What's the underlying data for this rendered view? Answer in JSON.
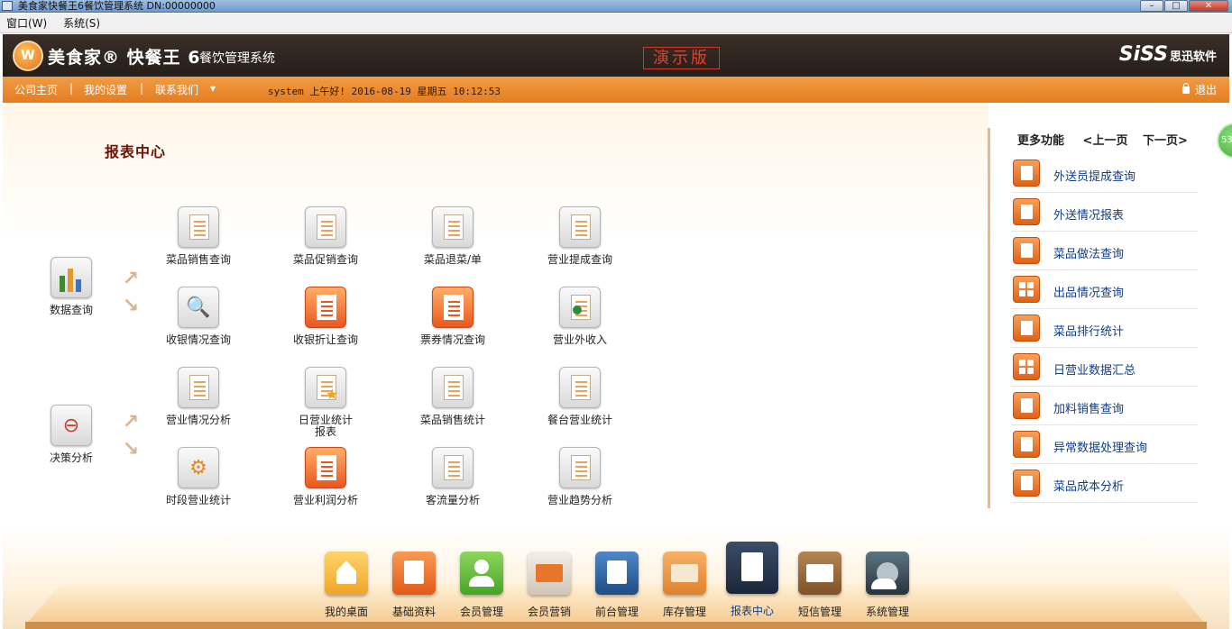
{
  "window": {
    "title": "美食家快餐王6餐饮管理系统 DN:00000000",
    "min_label": "–",
    "max_label": "□",
    "close_label": "✕"
  },
  "menubar": {
    "items": [
      "窗口(W)",
      "系统(S)"
    ]
  },
  "header": {
    "brand": "美食家® 快餐王 6",
    "subtitle": "餐饮管理系统",
    "demo_badge": "演示版",
    "vendor": "SiSS",
    "vendor_cn": "思迅软件",
    "logo_glyph": "W"
  },
  "nav": {
    "home": "公司主页",
    "settings": "我的设置",
    "contact": "联系我们",
    "contact_caret": "▾",
    "separator": "|",
    "greeting": "system 上午好! 2016-08-19 星期五 10:12:53",
    "logout": "退出"
  },
  "main": {
    "section_title": "报表中心",
    "groups": [
      {
        "label": "数据查询",
        "icon": "bar-chart-icon"
      },
      {
        "label": "决策分析",
        "icon": "cart-icon"
      }
    ],
    "arrow_up": "↗",
    "arrow_down": "↘",
    "tiles": [
      {
        "label": "菜品销售查询",
        "icon": "clipboard-icon"
      },
      {
        "label": "菜品促销查询",
        "icon": "document-icon"
      },
      {
        "label": "菜品退菜/单",
        "icon": "document-icon"
      },
      {
        "label": "营业提成查询",
        "icon": "document-icon"
      },
      {
        "label": "收银情况查询",
        "icon": "magnifier-cash-icon"
      },
      {
        "label": "收银折让查询",
        "icon": "orange-document-icon"
      },
      {
        "label": "票券情况查询",
        "icon": "orange-document-icon"
      },
      {
        "label": "营业外收入",
        "icon": "person-document-icon"
      },
      {
        "label": "营业情况分析",
        "icon": "magnifier-document-icon"
      },
      {
        "label": "日营业统计报表",
        "icon": "star-document-icon"
      },
      {
        "label": "菜品销售统计",
        "icon": "document-icon"
      },
      {
        "label": "餐台营业统计",
        "icon": "document-icon"
      },
      {
        "label": "时段营业统计",
        "icon": "folder-gear-icon"
      },
      {
        "label": "营业利润分析",
        "icon": "orange-arrow-document-icon"
      },
      {
        "label": "客流量分析",
        "icon": "box-document-icon"
      },
      {
        "label": "营业趋势分析",
        "icon": "box-document-icon"
      }
    ]
  },
  "sidebar": {
    "title": "更多功能",
    "prev": "<上一页",
    "next": "下一页>",
    "items": [
      {
        "label": "外送员提成查询",
        "icon": "folder-arrow-icon"
      },
      {
        "label": "外送情况报表",
        "icon": "document-arrow-icon"
      },
      {
        "label": "菜品做法查询",
        "icon": "folder-arrow-icon"
      },
      {
        "label": "出品情况查询",
        "icon": "grid-icon"
      },
      {
        "label": "菜品排行统计",
        "icon": "document-star-icon"
      },
      {
        "label": "日营业数据汇总",
        "icon": "grid-icon"
      },
      {
        "label": "加料销售查询",
        "icon": "document-star-icon"
      },
      {
        "label": "异常数据处理查询",
        "icon": "document-icon"
      },
      {
        "label": "菜品成本分析",
        "icon": "document-arrow-icon"
      }
    ],
    "floating_badge": "53"
  },
  "dock": {
    "items": [
      {
        "label": "我的桌面",
        "icon": "home-icon",
        "color": "#f2b53a"
      },
      {
        "label": "基础资料",
        "icon": "document-icon",
        "color": "#e8641d"
      },
      {
        "label": "会员管理",
        "icon": "member-icon",
        "color": "#5cb533"
      },
      {
        "label": "会员营销",
        "icon": "marketing-icon",
        "color": "#e7e0d4"
      },
      {
        "label": "前台管理",
        "icon": "frontdesk-icon",
        "color": "#2f5f9c"
      },
      {
        "label": "库存管理",
        "icon": "inventory-icon",
        "color": "#e89240"
      },
      {
        "label": "报表中心",
        "icon": "report-icon",
        "color": "#24354f"
      },
      {
        "label": "短信管理",
        "icon": "envelope-icon",
        "color": "#9a6a3a"
      },
      {
        "label": "系统管理",
        "icon": "gear-icon",
        "color": "#3a4a56"
      }
    ]
  }
}
